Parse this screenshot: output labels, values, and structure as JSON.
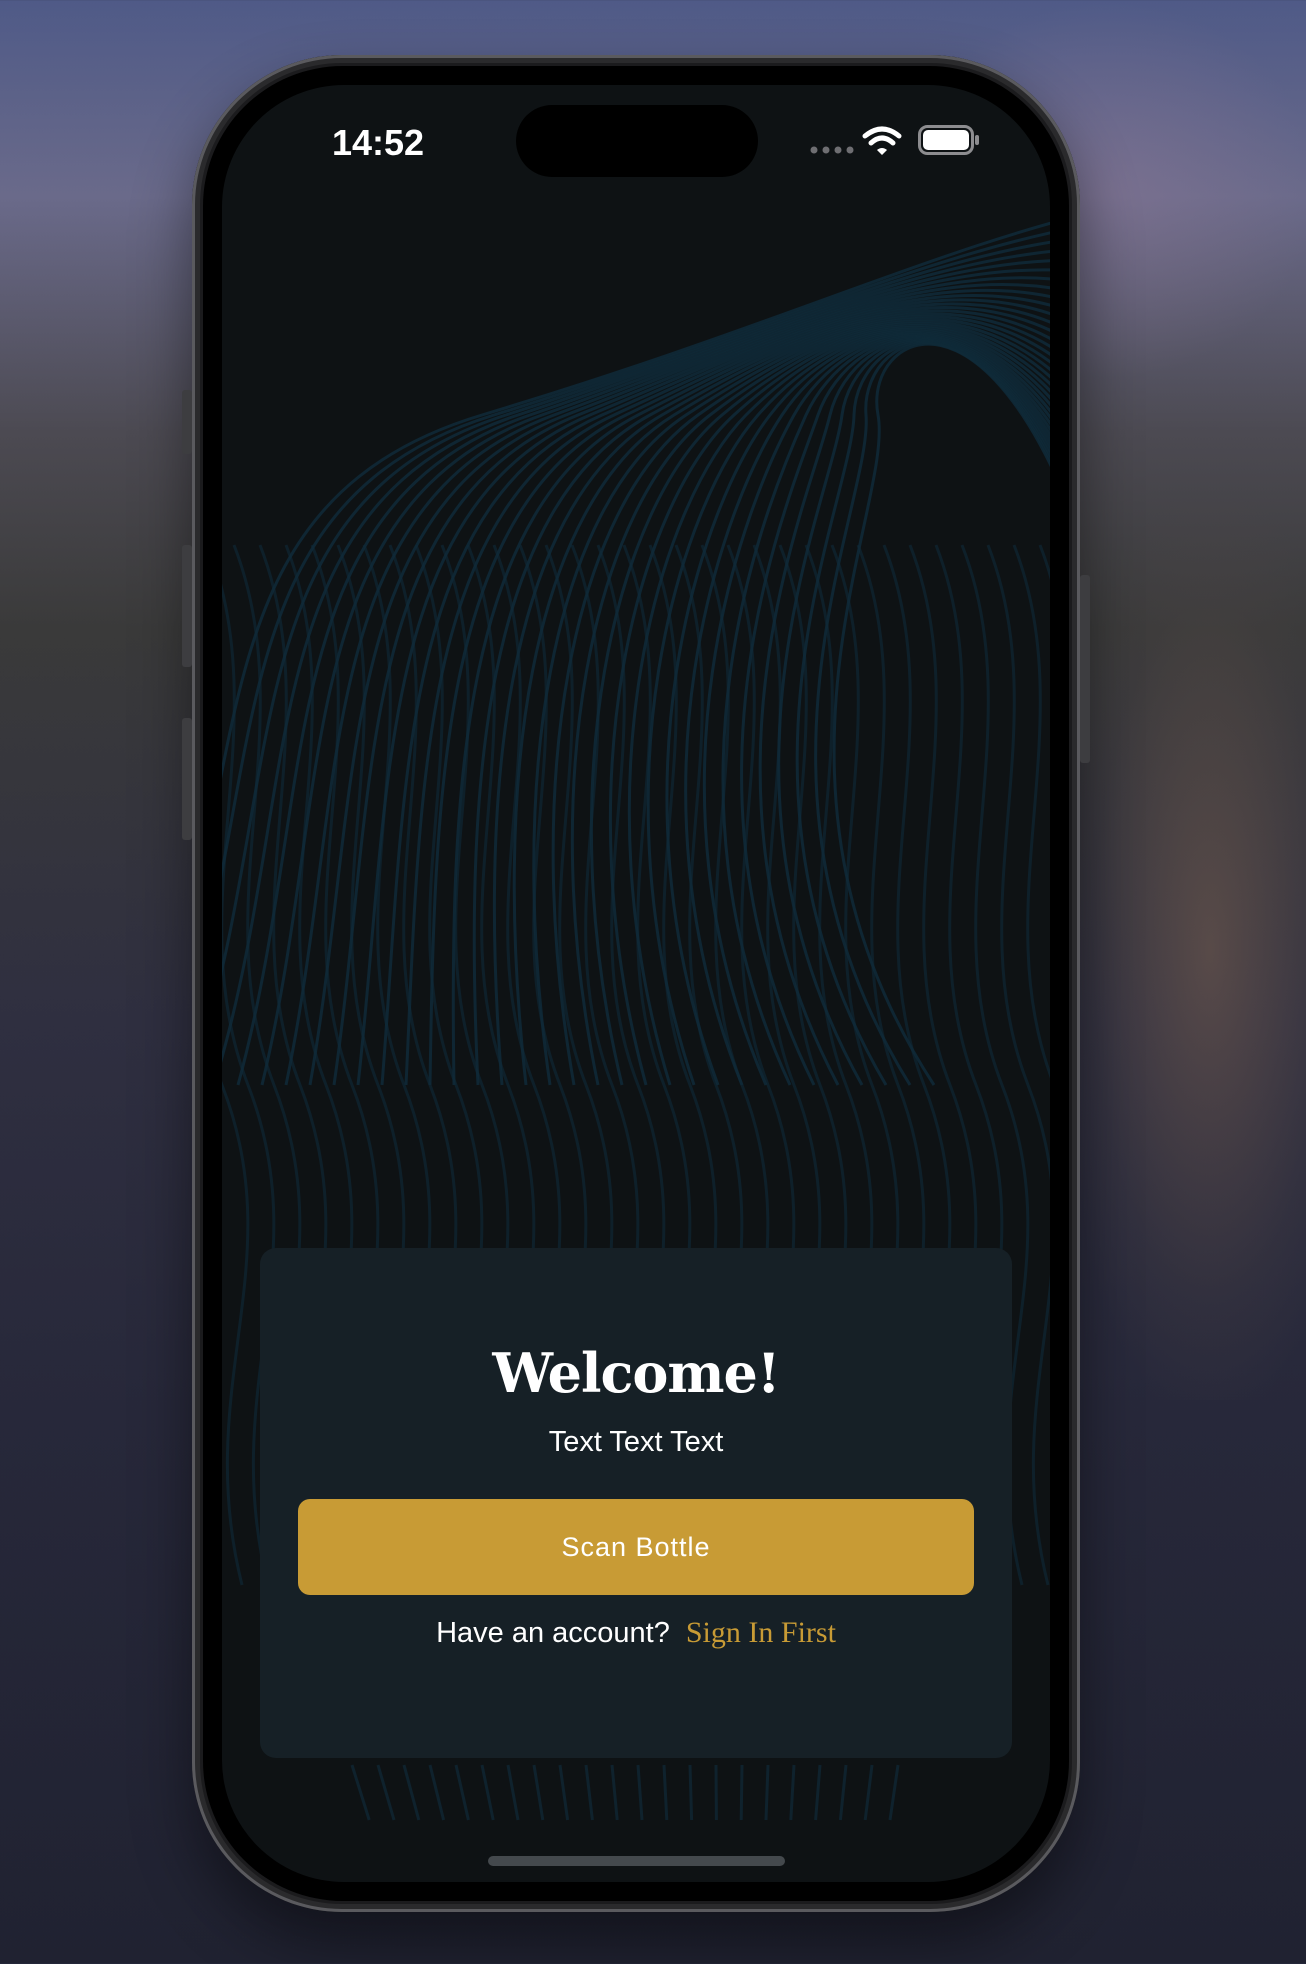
{
  "status_bar": {
    "time": "14:52",
    "wifi_icon": "wifi-icon",
    "battery_icon": "battery-icon",
    "signal_icon": "cellular-signal-icon"
  },
  "welcome_card": {
    "title": "Welcome!",
    "subtitle": "Text Text Text",
    "scan_button_label": "Scan Bottle",
    "account_prompt": "Have an account?",
    "sign_in_label": "Sign In First"
  },
  "colors": {
    "accent": "#c89b35",
    "screen_background": "#0e1214",
    "card_background": "#162026",
    "wave_lines": "#0f2a38"
  }
}
